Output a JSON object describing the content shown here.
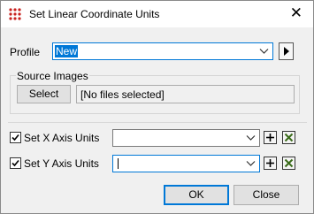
{
  "window": {
    "title": "Set Linear Coordinate Units"
  },
  "profile": {
    "label": "Profile",
    "value": "New"
  },
  "source_images": {
    "group_label": "Source Images",
    "select_label": "Select",
    "files_text": "[No files selected]"
  },
  "x_axis": {
    "label": "Set X Axis Units",
    "checked": true,
    "value": ""
  },
  "y_axis": {
    "label": "Set Y Axis Units",
    "checked": true,
    "value": ""
  },
  "buttons": {
    "ok": "OK",
    "close": "Close"
  },
  "colors": {
    "accent": "#0078d7",
    "delete_x": "#3a6b1a",
    "icon_red": "#c8201e"
  }
}
